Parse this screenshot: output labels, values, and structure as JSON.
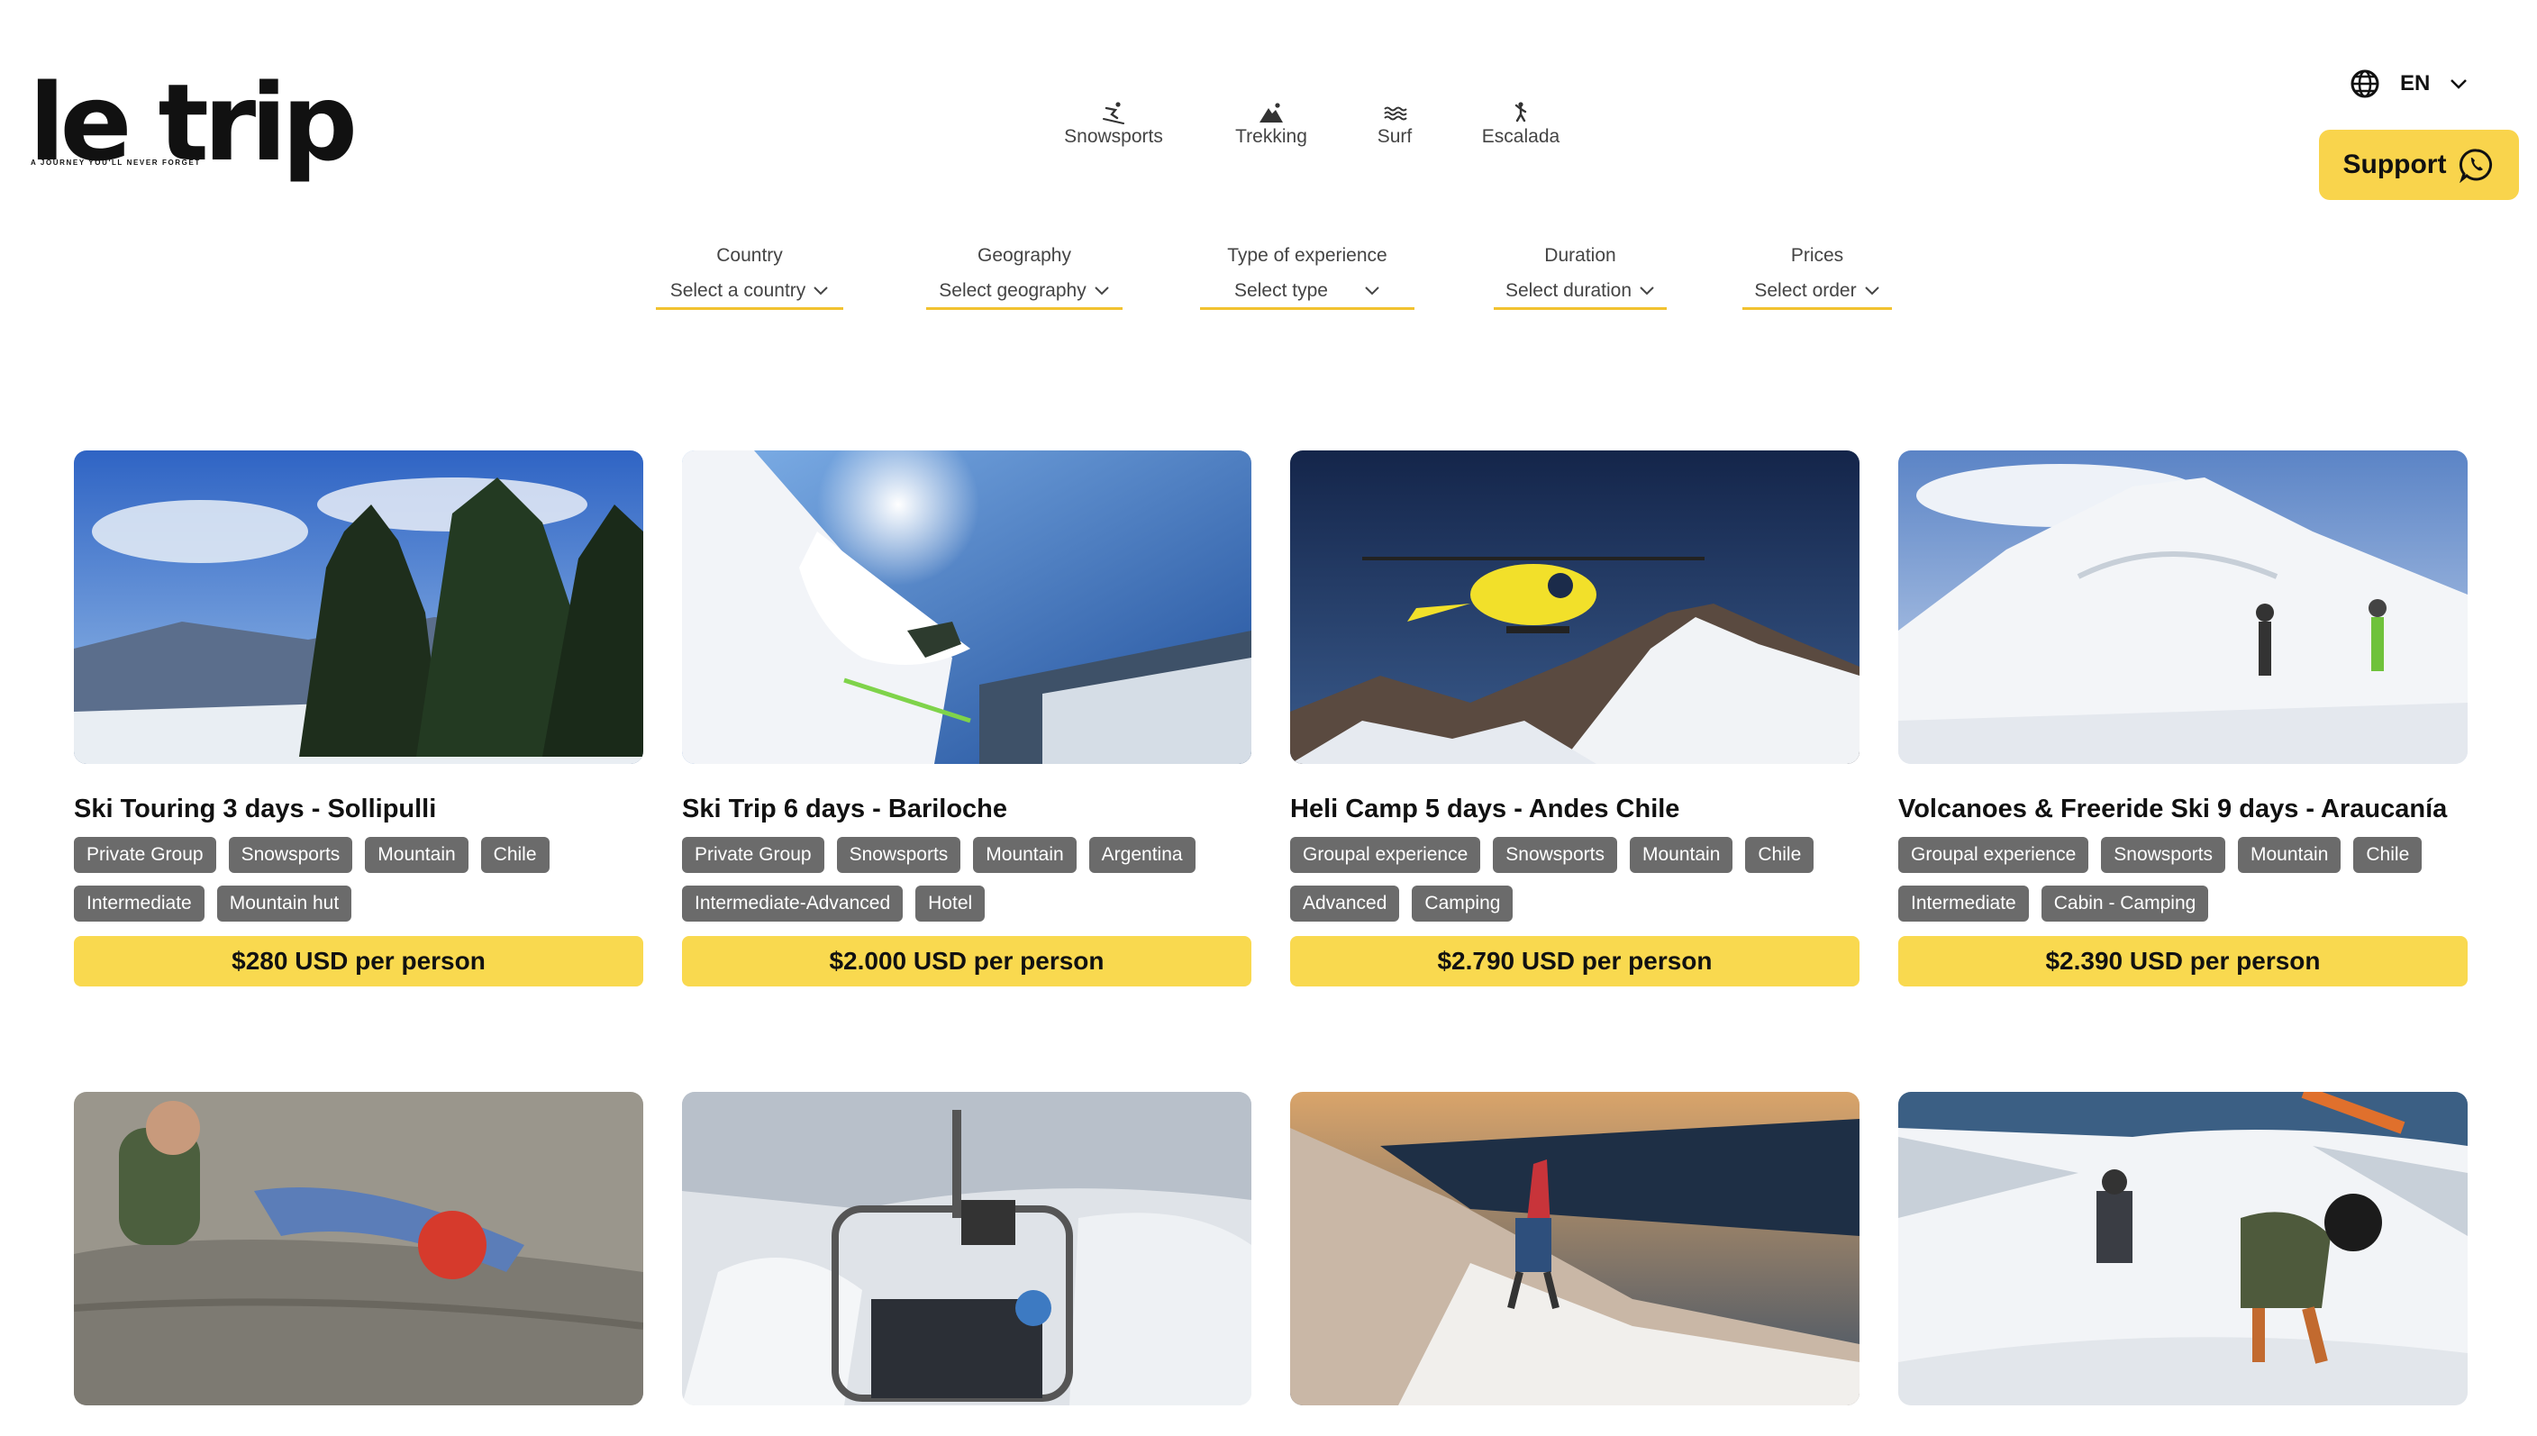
{
  "brand": {
    "logo_text": "le trip",
    "tagline": "A JOURNEY YOU'LL NEVER FORGET"
  },
  "nav": [
    {
      "label": "Snowsports",
      "icon": "skier-icon"
    },
    {
      "label": "Trekking",
      "icon": "mountain-icon"
    },
    {
      "label": "Surf",
      "icon": "waves-icon"
    },
    {
      "label": "Escalada",
      "icon": "climber-icon"
    }
  ],
  "language": {
    "code": "EN",
    "icon": "globe-icon"
  },
  "support": {
    "label": "Support",
    "icon": "whatsapp-icon"
  },
  "filters": [
    {
      "label": "Country",
      "value": "Select a country"
    },
    {
      "label": "Geography",
      "value": "Select geography"
    },
    {
      "label": "Type of experience",
      "value": "Select type"
    },
    {
      "label": "Duration",
      "value": "Select duration"
    },
    {
      "label": "Prices",
      "value": "Select order"
    }
  ],
  "cards": [
    {
      "title": "Ski Touring 3 days - Sollipulli",
      "tags": [
        "Private Group",
        "Snowsports",
        "Mountain",
        "Chile",
        "Intermediate",
        "Mountain hut"
      ],
      "price": "$280 USD per person"
    },
    {
      "title": "Ski Trip 6 days - Bariloche",
      "tags": [
        "Private Group",
        "Snowsports",
        "Mountain",
        "Argentina",
        "Intermediate-Advanced",
        "Hotel"
      ],
      "price": "$2.000 USD per person"
    },
    {
      "title": "Heli Camp 5 days - Andes Chile",
      "tags": [
        "Groupal experience",
        "Snowsports",
        "Mountain",
        "Chile",
        "Advanced",
        "Camping"
      ],
      "price": "$2.790 USD per person"
    },
    {
      "title": "Volcanoes & Freeride Ski 9 days - Araucanía",
      "tags": [
        "Groupal experience",
        "Snowsports",
        "Mountain",
        "Chile",
        "Intermediate",
        "Cabin - Camping"
      ],
      "price": "$2.390 USD per person"
    }
  ],
  "colors": {
    "accent": "#f9d94f",
    "tag_bg": "#6b6b6b",
    "filter_underline": "#f2c230"
  }
}
